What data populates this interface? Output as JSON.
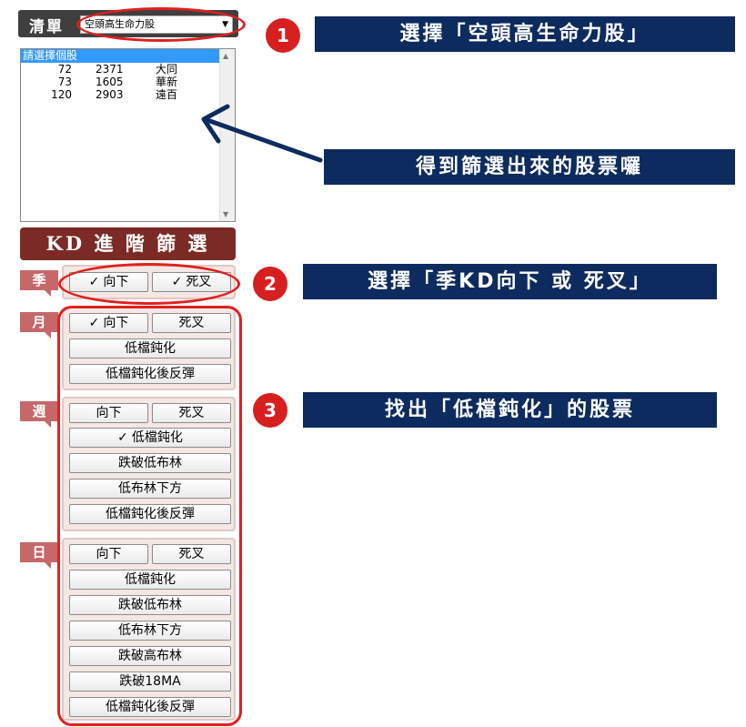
{
  "list_panel": {
    "label": "清單",
    "selected_option": "空頭高生命力股",
    "listbox": {
      "header": "請選擇個股",
      "rows": [
        {
          "rank": "72",
          "code": "2371",
          "name": "大同"
        },
        {
          "rank": "73",
          "code": "1605",
          "name": "華新"
        },
        {
          "rank": "120",
          "code": "2903",
          "name": "遠百"
        }
      ]
    }
  },
  "kd_banner": "KD 進 階 篩 選",
  "season": {
    "tag": "季",
    "down": {
      "check": "✓",
      "label": "向下"
    },
    "death_cross": {
      "check": "✓",
      "label": "死叉"
    }
  },
  "month": {
    "tag": "月",
    "down": {
      "check": "✓",
      "label": "向下"
    },
    "death_cross": {
      "label": "死叉"
    },
    "buttons": [
      "低檔鈍化",
      "低檔鈍化後反彈"
    ]
  },
  "week": {
    "tag": "週",
    "down": {
      "label": "向下"
    },
    "death_cross": {
      "label": "死叉"
    },
    "low_dull": {
      "check": "✓",
      "label": "低檔鈍化"
    },
    "buttons": [
      "跌破低布林",
      "低布林下方",
      "低檔鈍化後反彈"
    ]
  },
  "day": {
    "tag": "日",
    "down": {
      "label": "向下"
    },
    "death_cross": {
      "label": "死叉"
    },
    "buttons": [
      "低檔鈍化",
      "跌破低布林",
      "低布林下方",
      "跌破高布林",
      "跌破18MA",
      "低檔鈍化後反彈"
    ]
  },
  "annotations": {
    "step1": {
      "num": "1",
      "text": "選擇「空頭高生命力股」"
    },
    "result": {
      "text": "得到篩選出來的股票囉"
    },
    "step2": {
      "num": "2",
      "text": "選擇「季KD向下 或 死叉」"
    },
    "step3": {
      "num": "3",
      "text": "找出「低檔鈍化」的股票"
    }
  },
  "colors": {
    "callout_bg": "#0d2b5e",
    "highlight_red": "#e02020",
    "banner_bg": "#7b2a25",
    "tag_bg": "#c6686a",
    "list_highlight": "#3399ff"
  }
}
